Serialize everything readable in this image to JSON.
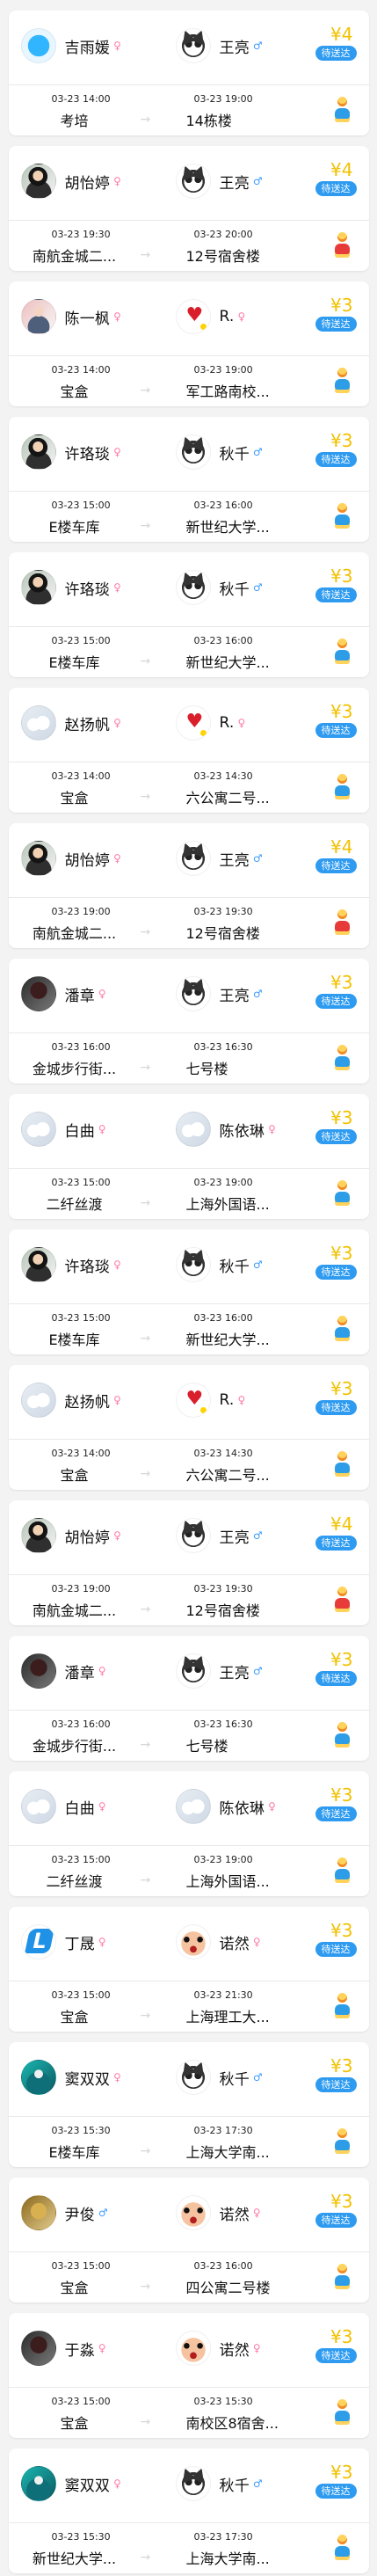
{
  "orders": [
    {
      "sender": {
        "name": "吉雨媛",
        "gender": "♀",
        "avatar_icon": "blue-circle-avatar-icon"
      },
      "receiver": {
        "name": "王亮",
        "gender": "♂",
        "avatar_icon": "cat-avatar-icon"
      },
      "price": "¥4",
      "status": "待送达",
      "from": {
        "time": "03-23 14:00",
        "place": "考培"
      },
      "to": {
        "time": "03-23 19:00",
        "place": "14栋楼"
      }
    },
    {
      "sender": {
        "name": "胡怡婷",
        "gender": "♀",
        "avatar_icon": "portrait-avatar-icon"
      },
      "receiver": {
        "name": "王亮",
        "gender": "♂",
        "avatar_icon": "cat-avatar-icon"
      },
      "price": "¥4",
      "status": "待送达",
      "from": {
        "time": "03-23 19:30",
        "place": "南航金城二..."
      },
      "to": {
        "time": "03-23 20:00",
        "place": "12号宿舍楼"
      }
    },
    {
      "sender": {
        "name": "陈一枫",
        "gender": "♀",
        "avatar_icon": "photo-avatar-icon"
      },
      "receiver": {
        "name": "R.",
        "gender": "♀",
        "avatar_icon": "heart-avatar-icon"
      },
      "price": "¥3",
      "status": "待送达",
      "from": {
        "time": "03-23 14:00",
        "place": "宝盒"
      },
      "to": {
        "time": "03-23 19:00",
        "place": "军工路南校..."
      }
    },
    {
      "sender": {
        "name": "许珞琰",
        "gender": "♀",
        "avatar_icon": "portrait-avatar-icon"
      },
      "receiver": {
        "name": "秋千",
        "gender": "♂",
        "avatar_icon": "cat-avatar-icon"
      },
      "price": "¥3",
      "status": "待送达",
      "from": {
        "time": "03-23 15:00",
        "place": "E楼车库"
      },
      "to": {
        "time": "03-23 16:00",
        "place": "新世纪大学..."
      }
    },
    {
      "sender": {
        "name": "许珞琰",
        "gender": "♀",
        "avatar_icon": "portrait-avatar-icon"
      },
      "receiver": {
        "name": "秋千",
        "gender": "♂",
        "avatar_icon": "cat-avatar-icon"
      },
      "price": "¥3",
      "status": "待送达",
      "from": {
        "time": "03-23 15:00",
        "place": "E楼车库"
      },
      "to": {
        "time": "03-23 16:00",
        "place": "新世纪大学..."
      }
    },
    {
      "sender": {
        "name": "赵扬帆",
        "gender": "♀",
        "avatar_icon": "cloud-avatar-icon"
      },
      "receiver": {
        "name": "R.",
        "gender": "♀",
        "avatar_icon": "heart-avatar-icon"
      },
      "price": "¥3",
      "status": "待送达",
      "from": {
        "time": "03-23 14:00",
        "place": "宝盒"
      },
      "to": {
        "time": "03-23 14:30",
        "place": "六公寓二号..."
      }
    },
    {
      "sender": {
        "name": "胡怡婷",
        "gender": "♀",
        "avatar_icon": "portrait-avatar-icon"
      },
      "receiver": {
        "name": "王亮",
        "gender": "♂",
        "avatar_icon": "cat-avatar-icon"
      },
      "price": "¥4",
      "status": "待送达",
      "from": {
        "time": "03-23 19:00",
        "place": "南航金城二..."
      },
      "to": {
        "time": "03-23 19:30",
        "place": "12号宿舍楼"
      }
    },
    {
      "sender": {
        "name": "潘章",
        "gender": "♀",
        "avatar_icon": "dark-avatar-icon"
      },
      "receiver": {
        "name": "王亮",
        "gender": "♂",
        "avatar_icon": "cat-avatar-icon"
      },
      "price": "¥3",
      "status": "待送达",
      "from": {
        "time": "03-23 16:00",
        "place": "金城步行街..."
      },
      "to": {
        "time": "03-23 16:30",
        "place": "七号楼"
      }
    },
    {
      "sender": {
        "name": "白曲",
        "gender": "♀",
        "avatar_icon": "cloud-avatar-icon"
      },
      "receiver": {
        "name": "陈依琳",
        "gender": "♀",
        "avatar_icon": "cloud-avatar-icon"
      },
      "price": "¥3",
      "status": "待送达",
      "from": {
        "time": "03-23 15:00",
        "place": "二纤丝渡"
      },
      "to": {
        "time": "03-23 19:00",
        "place": "上海外国语..."
      }
    },
    {
      "sender": {
        "name": "许珞琰",
        "gender": "♀",
        "avatar_icon": "portrait-avatar-icon"
      },
      "receiver": {
        "name": "秋千",
        "gender": "♂",
        "avatar_icon": "cat-avatar-icon"
      },
      "price": "¥3",
      "status": "待送达",
      "from": {
        "time": "03-23 15:00",
        "place": "E楼车库"
      },
      "to": {
        "time": "03-23 16:00",
        "place": "新世纪大学..."
      }
    },
    {
      "sender": {
        "name": "赵扬帆",
        "gender": "♀",
        "avatar_icon": "cloud-avatar-icon"
      },
      "receiver": {
        "name": "R.",
        "gender": "♀",
        "avatar_icon": "heart-avatar-icon"
      },
      "price": "¥3",
      "status": "待送达",
      "from": {
        "time": "03-23 14:00",
        "place": "宝盒"
      },
      "to": {
        "time": "03-23 14:30",
        "place": "六公寓二号..."
      }
    },
    {
      "sender": {
        "name": "胡怡婷",
        "gender": "♀",
        "avatar_icon": "portrait-avatar-icon"
      },
      "receiver": {
        "name": "王亮",
        "gender": "♂",
        "avatar_icon": "cat-avatar-icon"
      },
      "price": "¥4",
      "status": "待送达",
      "from": {
        "time": "03-23 19:00",
        "place": "南航金城二..."
      },
      "to": {
        "time": "03-23 19:30",
        "place": "12号宿舍楼"
      }
    },
    {
      "sender": {
        "name": "潘章",
        "gender": "♀",
        "avatar_icon": "dark-avatar-icon"
      },
      "receiver": {
        "name": "王亮",
        "gender": "♂",
        "avatar_icon": "cat-avatar-icon"
      },
      "price": "¥3",
      "status": "待送达",
      "from": {
        "time": "03-23 16:00",
        "place": "金城步行街..."
      },
      "to": {
        "time": "03-23 16:30",
        "place": "七号楼"
      }
    },
    {
      "sender": {
        "name": "白曲",
        "gender": "♀",
        "avatar_icon": "cloud-avatar-icon"
      },
      "receiver": {
        "name": "陈依琳",
        "gender": "♀",
        "avatar_icon": "cloud-avatar-icon"
      },
      "price": "¥3",
      "status": "待送达",
      "from": {
        "time": "03-23 15:00",
        "place": "二纤丝渡"
      },
      "to": {
        "time": "03-23 19:00",
        "place": "上海外国语..."
      }
    },
    {
      "sender": {
        "name": "丁晟",
        "gender": "♀",
        "avatar_icon": "logo-avatar-icon"
      },
      "receiver": {
        "name": "诺然",
        "gender": "♀",
        "avatar_icon": "face-avatar-icon"
      },
      "price": "¥3",
      "status": "待送达",
      "from": {
        "time": "03-23 15:00",
        "place": "宝盒"
      },
      "to": {
        "time": "03-23 21:30",
        "place": "上海理工大..."
      }
    },
    {
      "sender": {
        "name": "窦双双",
        "gender": "♀",
        "avatar_icon": "teal-avatar-icon"
      },
      "receiver": {
        "name": "秋千",
        "gender": "♂",
        "avatar_icon": "cat-avatar-icon"
      },
      "price": "¥3",
      "status": "待送达",
      "from": {
        "time": "03-23 15:30",
        "place": "E楼车库"
      },
      "to": {
        "time": "03-23 17:30",
        "place": "上海大学南..."
      }
    },
    {
      "sender": {
        "name": "尹俊",
        "gender": "♂",
        "avatar_icon": "golden-avatar-icon"
      },
      "receiver": {
        "name": "诺然",
        "gender": "♀",
        "avatar_icon": "face-avatar-icon"
      },
      "price": "¥3",
      "status": "待送达",
      "from": {
        "time": "03-23 15:00",
        "place": "宝盒"
      },
      "to": {
        "time": "03-23 16:00",
        "place": "四公寓二号楼"
      }
    },
    {
      "sender": {
        "name": "于淼",
        "gender": "♀",
        "avatar_icon": "dark-avatar-icon"
      },
      "receiver": {
        "name": "诺然",
        "gender": "♀",
        "avatar_icon": "face-avatar-icon"
      },
      "price": "¥3",
      "status": "待送达",
      "from": {
        "time": "03-23 15:00",
        "place": "宝盒"
      },
      "to": {
        "time": "03-23 15:30",
        "place": "南校区8宿舍..."
      }
    },
    {
      "sender": {
        "name": "窦双双",
        "gender": "♀",
        "avatar_icon": "teal-avatar-icon"
      },
      "receiver": {
        "name": "秋千",
        "gender": "♂",
        "avatar_icon": "cat-avatar-icon"
      },
      "price": "¥3",
      "status": "待送达",
      "from": {
        "time": "03-23 15:30",
        "place": "新世纪大学..."
      },
      "to": {
        "time": "03-23 17:30",
        "place": "上海大学南..."
      }
    }
  ]
}
